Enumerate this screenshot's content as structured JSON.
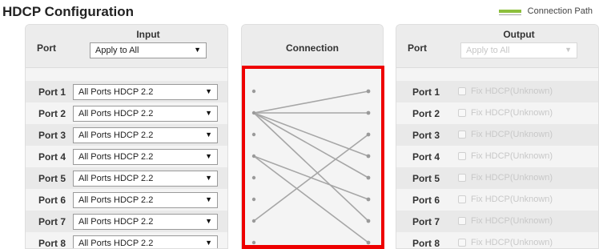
{
  "page": {
    "title": "HDCP Configuration"
  },
  "legend": {
    "label": "Connection Path",
    "color": "#8dbf3d"
  },
  "input": {
    "title": "Input",
    "port_header": "Port",
    "apply_all": {
      "value": "Apply to All"
    },
    "rows": [
      {
        "port": "Port 1",
        "value": "All Ports HDCP 2.2"
      },
      {
        "port": "Port 2",
        "value": "All Ports HDCP 2.2"
      },
      {
        "port": "Port 3",
        "value": "All Ports HDCP 2.2"
      },
      {
        "port": "Port 4",
        "value": "All Ports HDCP 2.2"
      },
      {
        "port": "Port 5",
        "value": "All Ports HDCP 2.2"
      },
      {
        "port": "Port 6",
        "value": "All Ports HDCP 2.2"
      },
      {
        "port": "Port 7",
        "value": "All Ports HDCP 2.2"
      },
      {
        "port": "Port 8",
        "value": "All Ports HDCP 2.2"
      }
    ]
  },
  "connection": {
    "title": "Connection",
    "highlight_color": "#ee0000",
    "line_color": "#a6a6a6",
    "routes": [
      {
        "input": 2,
        "output": 1
      },
      {
        "input": 2,
        "output": 2
      },
      {
        "input": 2,
        "output": 4
      },
      {
        "input": 2,
        "output": 5
      },
      {
        "input": 2,
        "output": 7
      },
      {
        "input": 4,
        "output": 6
      },
      {
        "input": 4,
        "output": 8
      },
      {
        "input": 7,
        "output": 3
      }
    ]
  },
  "output": {
    "title": "Output",
    "port_header": "Port",
    "apply_all": {
      "value": "Apply to All"
    },
    "rows": [
      {
        "port": "Port 1",
        "label": "Fix HDCP(Unknown)"
      },
      {
        "port": "Port 2",
        "label": "Fix HDCP(Unknown)"
      },
      {
        "port": "Port 3",
        "label": "Fix HDCP(Unknown)"
      },
      {
        "port": "Port 4",
        "label": "Fix HDCP(Unknown)"
      },
      {
        "port": "Port 5",
        "label": "Fix HDCP(Unknown)"
      },
      {
        "port": "Port 6",
        "label": "Fix HDCP(Unknown)"
      },
      {
        "port": "Port 7",
        "label": "Fix HDCP(Unknown)"
      },
      {
        "port": "Port 8",
        "label": "Fix HDCP(Unknown)"
      }
    ]
  }
}
